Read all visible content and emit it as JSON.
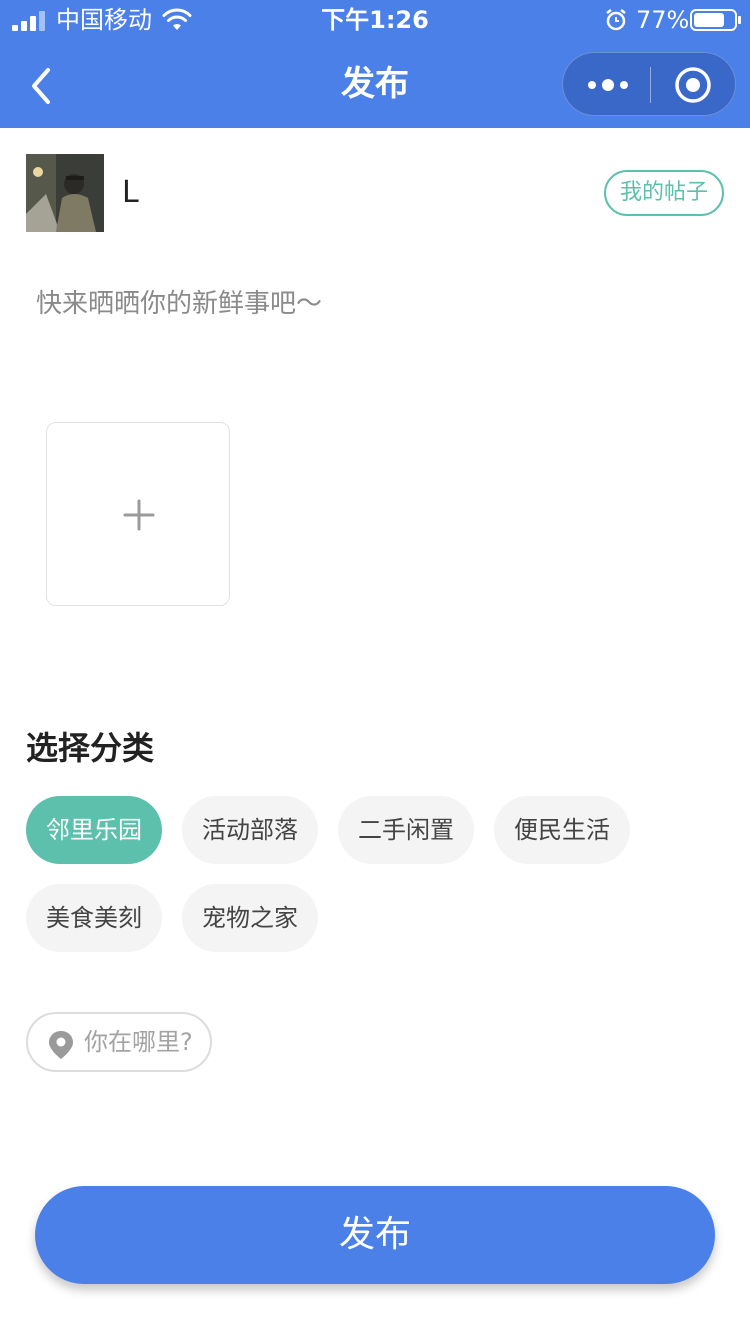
{
  "status_bar": {
    "carrier": "中国移动",
    "time": "下午1:26",
    "battery_percent": "77%",
    "battery_level": 0.77
  },
  "nav": {
    "title": "发布",
    "back_icon": "chevron-left-icon",
    "menu_icon": "more-dots-icon",
    "close_icon": "target-icon"
  },
  "user": {
    "name": "L",
    "my_posts_label": "我的帖子"
  },
  "post": {
    "placeholder": "快来晒晒你的新鲜事吧～",
    "value": ""
  },
  "upload": {
    "icon": "plus-icon"
  },
  "category": {
    "title": "选择分类",
    "items": [
      {
        "label": "邻里乐园",
        "active": true
      },
      {
        "label": "活动部落",
        "active": false
      },
      {
        "label": "二手闲置",
        "active": false
      },
      {
        "label": "便民生活",
        "active": false
      },
      {
        "label": "美食美刻",
        "active": false
      },
      {
        "label": "宠物之家",
        "active": false
      }
    ]
  },
  "location": {
    "label": "你在哪里?",
    "icon": "location-pin-icon"
  },
  "publish_button": {
    "label": "发布"
  },
  "colors": {
    "primary": "#4a80e8",
    "accent": "#5cc0ad",
    "chip_bg": "#f4f4f4"
  }
}
